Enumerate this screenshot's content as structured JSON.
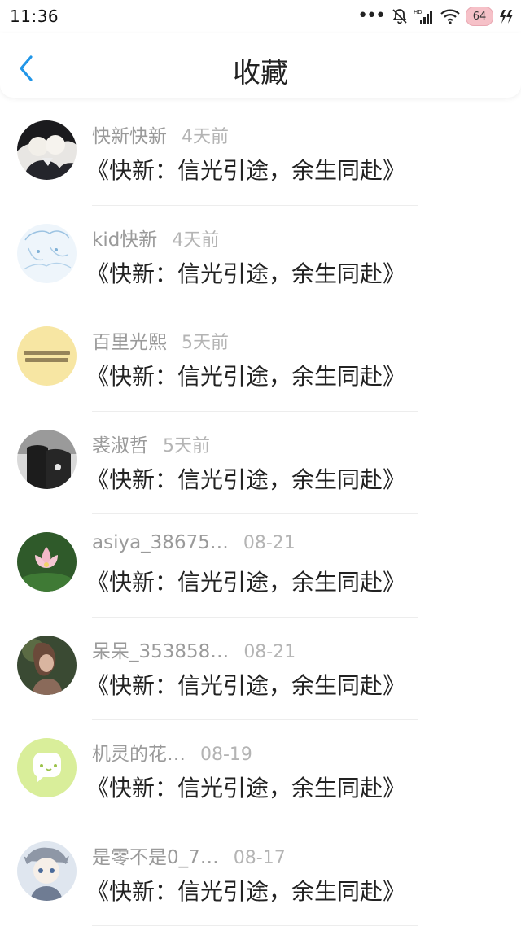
{
  "status_bar": {
    "time": "11:36",
    "battery": "64"
  },
  "header": {
    "title": "收藏"
  },
  "items": [
    {
      "name": "快新快新",
      "time": "4天前",
      "title": "《快新：信光引途，余生同赴》",
      "avatar": "avatar-dark-anime"
    },
    {
      "name": "kid快新",
      "time": "4天前",
      "title": "《快新：信光引途，余生同赴》",
      "avatar": "avatar-sketch"
    },
    {
      "name": "百里光熙",
      "time": "5天前",
      "title": "《快新：信光引途，余生同赴》",
      "avatar": "avatar-text-yellow"
    },
    {
      "name": "裘淑哲",
      "time": "5天前",
      "title": "《快新：信光引途，余生同赴》",
      "avatar": "avatar-dark-photo"
    },
    {
      "name": "asiya_38675…",
      "time": "08-21",
      "title": "《快新：信光引途，余生同赴》",
      "avatar": "avatar-lotus"
    },
    {
      "name": "呆呆_353858…",
      "time": "08-21",
      "title": "《快新：信光引途，余生同赴》",
      "avatar": "avatar-photo-girl"
    },
    {
      "name": "机灵的花…",
      "time": "08-19",
      "title": "《快新：信光引途，余生同赴》",
      "avatar": "avatar-green-chat"
    },
    {
      "name": "是零不是0_7…",
      "time": "08-17",
      "title": "《快新：信光引途，余生同赴》",
      "avatar": "avatar-chibi"
    }
  ]
}
